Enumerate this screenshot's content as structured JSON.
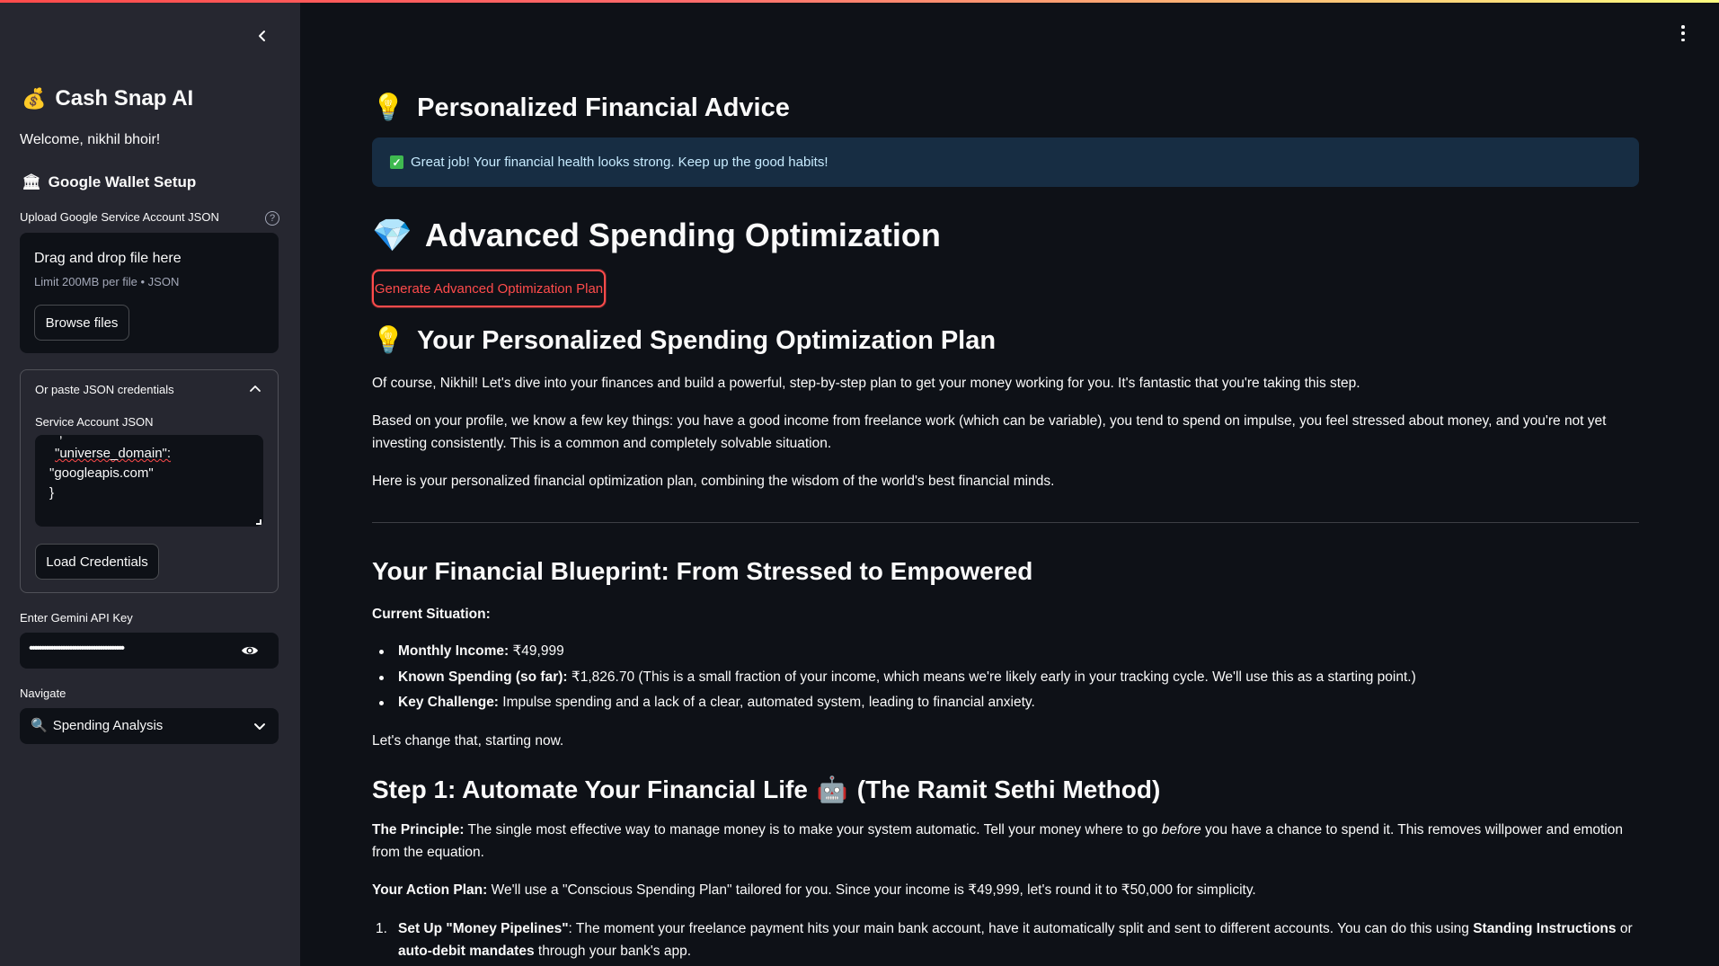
{
  "sidebar": {
    "app_title": "Cash Snap AI",
    "app_emoji": "💰",
    "welcome": "Welcome, nikhil bhoir!",
    "wallet_heading": "Google Wallet Setup",
    "wallet_emoji": "🏛",
    "upload_label": "Upload Google Service Account JSON",
    "help_glyph": "?",
    "dropzone_title": "Drag and drop file here",
    "dropzone_limit": "Limit 200MB per file • JSON",
    "browse_button": "Browse files",
    "paste_expander": "Or paste JSON credentials",
    "service_account_label": "Service Account JSON",
    "textarea_lines": [
      "\"\",",
      "\"universe_domain\":",
      "\"googleapis.com\"",
      "}"
    ],
    "load_button": "Load Credentials",
    "api_key_label": "Enter Gemini API Key",
    "api_key_masked": "••••••••••••••••••••••••••••••••••••••••",
    "navigate_label": "Navigate",
    "navigate_selected": "Spending Analysis",
    "navigate_emoji": "🔍"
  },
  "main": {
    "advice_heading": "Personalized Financial Advice",
    "bulb_emoji": "💡",
    "success_message": "Great job! Your financial health looks strong. Keep up the good habits!",
    "optimization_heading": "Advanced Spending Optimization",
    "gem_emoji": "💎",
    "generate_button": "Generate Advanced Optimization Plan",
    "plan_heading": "Your Personalized Spending Optimization Plan",
    "intro_p1": "Of course, Nikhil! Let's dive into your finances and build a powerful, step-by-step plan to get your money working for you. It's fantastic that you're taking this step.",
    "intro_p2": "Based on your profile, we know a few key things: you have a good income from freelance work (which can be variable), you tend to spend on impulse, you feel stressed about money, and you're not yet investing consistently. This is a common and completely solvable situation.",
    "intro_p3": "Here is your personalized financial optimization plan, combining the wisdom of the world's best financial minds.",
    "blueprint_heading": "Your Financial Blueprint: From Stressed to Empowered",
    "current_situation": "Current Situation:",
    "situation_items": [
      {
        "label": "Monthly Income:",
        "text": " ₹49,999"
      },
      {
        "label": "Known Spending (so far):",
        "text": " ₹1,826.70 (This is a small fraction of your income, which means we're likely early in your tracking cycle. We'll use this as a starting point.)"
      },
      {
        "label": "Key Challenge:",
        "text": " Impulse spending and a lack of a clear, automated system, leading to financial anxiety."
      }
    ],
    "change_line": "Let's change that, starting now.",
    "step1_before": "Step 1: Automate Your Financial Life",
    "step1_emoji": "🤖",
    "step1_after": "(The Ramit Sethi Method)",
    "principle_label": "The Principle:",
    "principle_text_a": " The single most effective way to manage money is to make your system automatic. Tell your money where to go ",
    "principle_em": "before",
    "principle_text_b": " you have a chance to spend it. This removes willpower and emotion from the equation.",
    "action_label": "Your Action Plan:",
    "action_text": " We'll use a \"Conscious Spending Plan\" tailored for you. Since your income is ₹49,999, let's round it to ₹50,000 for simplicity.",
    "list_number": "1.",
    "item1_label": "Set Up \"Money Pipelines\"",
    "item1_text_a": ": The moment your freelance payment hits your main bank account, have it automatically split and sent to different accounts. You can do this using ",
    "item1_bold_1": "Standing Instructions",
    "item1_or": " or ",
    "item1_bold_2": "auto-debit mandates",
    "item1_text_b": " through your bank's app."
  },
  "colors": {
    "accent": "#ff4b4b",
    "sidebar_bg": "#262730",
    "main_bg": "#0e1117",
    "alert_bg": "#172d43",
    "alert_text": "#c7ebff"
  },
  "icons": [
    "chevron-left-icon",
    "kebab-menu-icon",
    "help-icon",
    "chevron-up-icon",
    "eye-icon",
    "chevron-down-icon",
    "check-icon"
  ]
}
